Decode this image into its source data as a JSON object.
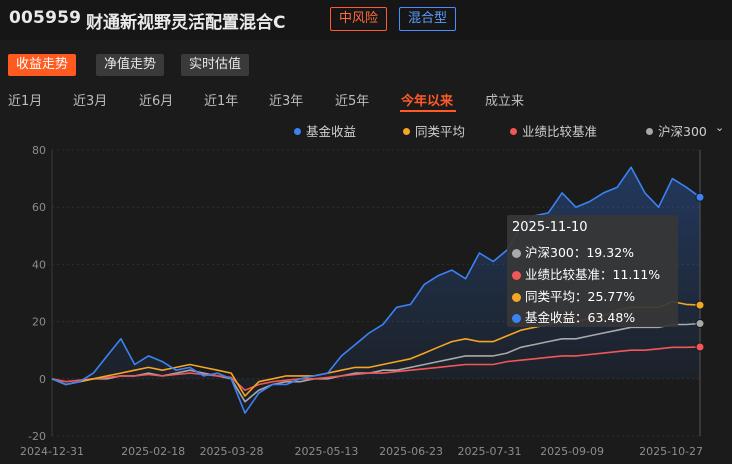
{
  "header": {
    "code": "005959",
    "name": "财通新视野灵活配置混合C",
    "risk_badge": "中风险",
    "type_badge": "混合型"
  },
  "view_tabs": [
    "收益走势",
    "净值走势",
    "实时估值"
  ],
  "ranges": [
    "近1月",
    "近3月",
    "近6月",
    "近1年",
    "近3年",
    "近5年",
    "今年以来",
    "成立来"
  ],
  "legend": [
    {
      "label": "基金收益",
      "color": "#3b82f6"
    },
    {
      "label": "同类平均",
      "color": "#f5a623"
    },
    {
      "label": "业绩比较基准",
      "color": "#f25757"
    },
    {
      "label": "沪深300",
      "color": "#a9a9a9"
    }
  ],
  "tooltip": {
    "date": "2025-11-10",
    "rows": [
      {
        "label": "沪深300：19.32%",
        "color": "#a9a9a9"
      },
      {
        "label": "业绩比较基准：11.11%",
        "color": "#f25757"
      },
      {
        "label": "同类平均：25.77%",
        "color": "#f5a623"
      },
      {
        "label": "基金收益：63.48%",
        "color": "#3b82f6"
      }
    ]
  },
  "chart_data": {
    "type": "line",
    "ylim": [
      -20,
      80
    ],
    "y_ticks": [
      80,
      60,
      40,
      20,
      0,
      -20
    ],
    "x_ticks": [
      "2024-12-31",
      "2025-02-18",
      "2025-03-28",
      "2025-05-13",
      "2025-06-23",
      "2025-07-31",
      "2025-09-09",
      "2025-10-27"
    ],
    "x": [
      "2024-12-31",
      "2025-01-07",
      "2025-01-14",
      "2025-01-21",
      "2025-01-28",
      "2025-02-04",
      "2025-02-11",
      "2025-02-18",
      "2025-02-25",
      "2025-03-04",
      "2025-03-11",
      "2025-03-18",
      "2025-03-25",
      "2025-03-28",
      "2025-04-01",
      "2025-04-07",
      "2025-04-14",
      "2025-04-21",
      "2025-04-28",
      "2025-05-06",
      "2025-05-13",
      "2025-05-20",
      "2025-05-27",
      "2025-06-03",
      "2025-06-10",
      "2025-06-16",
      "2025-06-23",
      "2025-06-30",
      "2025-07-07",
      "2025-07-14",
      "2025-07-21",
      "2025-07-28",
      "2025-07-31",
      "2025-08-07",
      "2025-08-14",
      "2025-08-21",
      "2025-08-28",
      "2025-09-04",
      "2025-09-09",
      "2025-09-16",
      "2025-09-23",
      "2025-09-30",
      "2025-10-09",
      "2025-10-16",
      "2025-10-23",
      "2025-10-27",
      "2025-11-03",
      "2025-11-10"
    ],
    "series": [
      {
        "name": "基金收益",
        "color": "#3b82f6",
        "values": [
          0,
          -2,
          -1,
          2,
          8,
          14,
          5,
          8,
          6,
          3,
          4,
          1,
          2,
          0,
          -12,
          -5,
          -2,
          -2,
          0,
          1,
          2,
          8,
          12,
          16,
          19,
          25,
          26,
          33,
          36,
          38,
          35,
          44,
          41,
          45,
          53,
          57,
          58,
          65,
          60,
          62,
          65,
          67,
          74,
          65,
          60,
          70,
          67,
          63.48
        ]
      },
      {
        "name": "同类平均",
        "color": "#f5a623",
        "values": [
          0,
          -2,
          -1,
          0,
          1,
          2,
          3,
          4,
          3,
          4,
          5,
          4,
          3,
          2,
          -6,
          -1,
          0,
          1,
          1,
          1,
          2,
          3,
          4,
          4,
          5,
          6,
          7,
          9,
          11,
          13,
          14,
          13,
          13,
          15,
          17,
          18,
          19,
          21,
          20,
          21,
          22,
          24,
          25,
          25,
          25,
          27,
          26,
          25.77
        ]
      },
      {
        "name": "业绩比较基准",
        "color": "#f25757",
        "values": [
          0,
          -1,
          -0.5,
          0,
          0.5,
          1,
          1,
          1.5,
          1,
          1.5,
          2,
          1.5,
          1,
          0.5,
          -4,
          -2,
          -1,
          -0.5,
          0,
          0,
          0.5,
          1,
          1.5,
          2,
          2,
          2.5,
          3,
          3.5,
          4,
          4.5,
          5,
          5,
          5,
          6,
          6.5,
          7,
          7.5,
          8,
          8,
          8.5,
          9,
          9.5,
          10,
          10,
          10.5,
          11,
          11,
          11.11
        ]
      },
      {
        "name": "沪深300",
        "color": "#a9a9a9",
        "values": [
          0,
          -2,
          -1,
          0,
          0,
          1,
          1,
          2,
          1,
          2,
          3,
          2,
          1,
          0,
          -8,
          -4,
          -2,
          -1,
          -1,
          0,
          0,
          1,
          2,
          2,
          3,
          3,
          4,
          5,
          6,
          7,
          8,
          8,
          8,
          9,
          11,
          12,
          13,
          14,
          14,
          15,
          16,
          17,
          18,
          18,
          18,
          19,
          19,
          19.32
        ]
      }
    ]
  }
}
